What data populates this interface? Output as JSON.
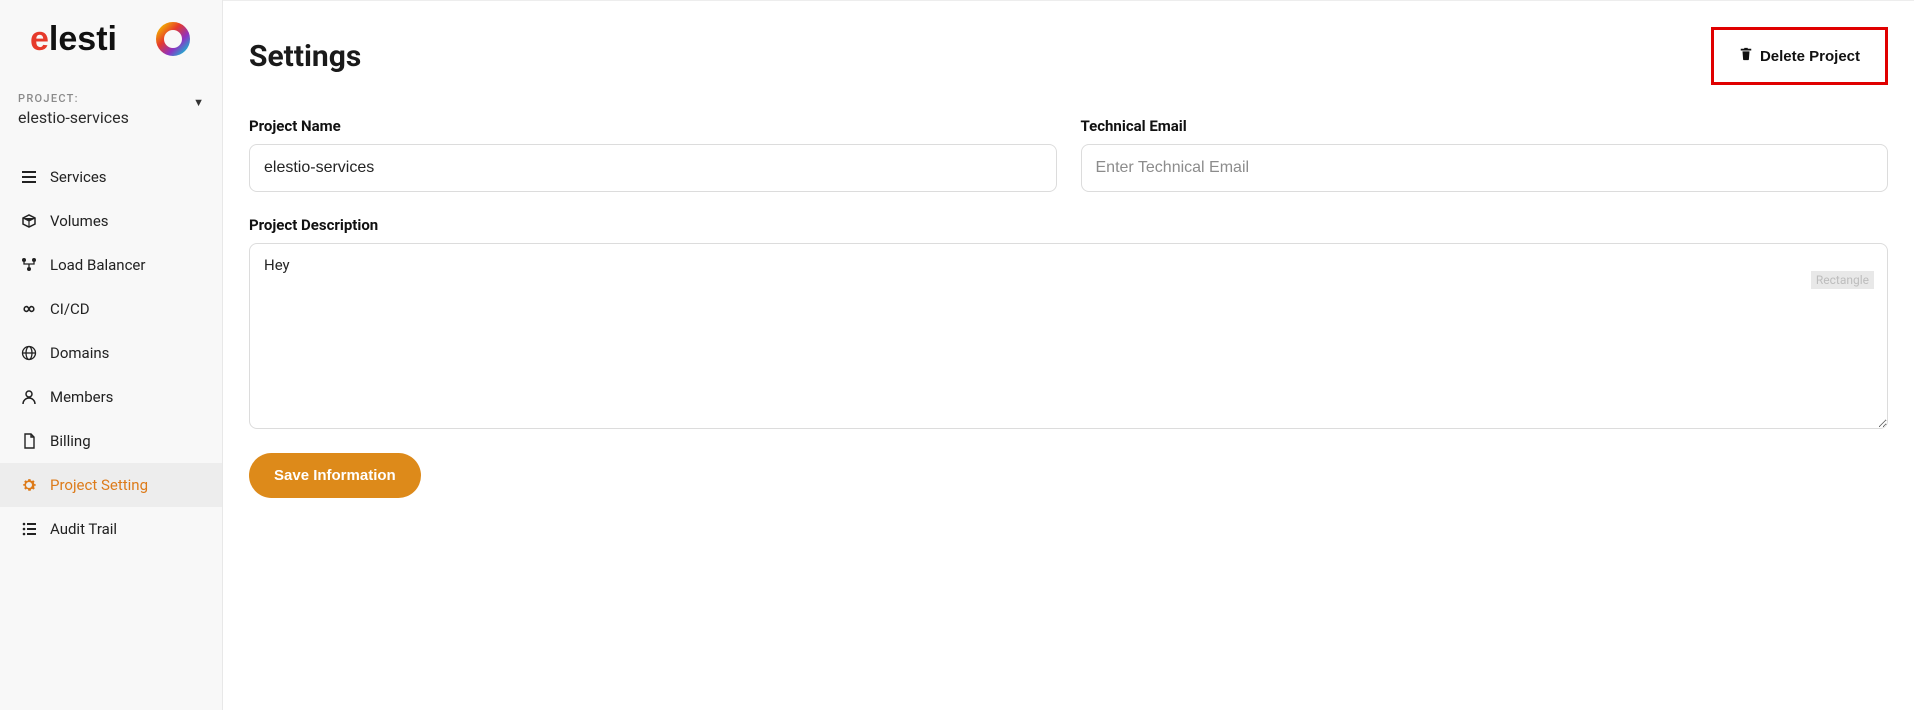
{
  "brand": "elestio",
  "project_selector": {
    "label": "PROJECT:",
    "value": "elestio-services"
  },
  "sidebar": {
    "items": [
      {
        "label": "Services",
        "icon": "list-icon"
      },
      {
        "label": "Volumes",
        "icon": "box-icon"
      },
      {
        "label": "Load Balancer",
        "icon": "balance-icon"
      },
      {
        "label": "CI/CD",
        "icon": "infinity-icon"
      },
      {
        "label": "Domains",
        "icon": "globe-icon"
      },
      {
        "label": "Members",
        "icon": "user-icon"
      },
      {
        "label": "Billing",
        "icon": "file-icon"
      },
      {
        "label": "Project Setting",
        "icon": "gear-icon"
      },
      {
        "label": "Audit Trail",
        "icon": "audit-icon"
      }
    ]
  },
  "page": {
    "title": "Settings",
    "delete_label": "Delete Project"
  },
  "form": {
    "project_name_label": "Project Name",
    "project_name_value": "elestio-services",
    "technical_email_label": "Technical Email",
    "technical_email_placeholder": "Enter Technical Email",
    "technical_email_value": "",
    "description_label": "Project Description",
    "description_value": "Hey",
    "save_label": "Save Information",
    "rectangle_tag": "Rectangle"
  },
  "colors": {
    "accent": "#dd8a1a",
    "highlight_red": "#e00000"
  }
}
